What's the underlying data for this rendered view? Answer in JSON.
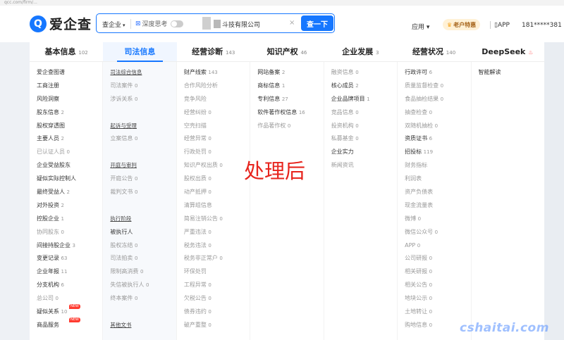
{
  "url": "qcc.com/firm/...",
  "header": {
    "logo_mark": "Q",
    "logo_text": "爱企查",
    "scope": "查企业",
    "deep": "深度思考",
    "query": "斗技有限公司",
    "search_btn": "查一下",
    "app_menu": "应用",
    "vip": "老户特惠",
    "app_link": "APP",
    "phone": "181*****381"
  },
  "tabs": [
    {
      "label": "基本信息",
      "count": "102"
    },
    {
      "label": "司法信息",
      "count": ""
    },
    {
      "label": "经营诊断",
      "count": "143"
    },
    {
      "label": "知识产权",
      "count": "46"
    },
    {
      "label": "企业发展",
      "count": "3"
    },
    {
      "label": "经营状况",
      "count": "140"
    },
    {
      "label": "DeepSeek",
      "count": ""
    }
  ],
  "columns": [
    [
      {
        "t": "爱企查图谱",
        "n": ""
      },
      {
        "t": "工商注册",
        "n": ""
      },
      {
        "t": "风险洞察",
        "n": ""
      },
      {
        "t": "股东信息",
        "n": "2"
      },
      {
        "t": "股权穿透图",
        "n": ""
      },
      {
        "t": "主要人员",
        "n": "2"
      },
      {
        "t": "已认证人员",
        "n": "0",
        "dim": true
      },
      {
        "t": "企业受益股东",
        "n": ""
      },
      {
        "t": "疑似实际控制人",
        "n": ""
      },
      {
        "t": "最终受益人",
        "n": "2"
      },
      {
        "t": "对外投资",
        "n": "2"
      },
      {
        "t": "控股企业",
        "n": "1"
      },
      {
        "t": "协同股东",
        "n": "0",
        "dim": true
      },
      {
        "t": "间接持股企业",
        "n": "3"
      },
      {
        "t": "变更记录",
        "n": "63"
      },
      {
        "t": "企业年报",
        "n": "11"
      },
      {
        "t": "分支机构",
        "n": "6"
      },
      {
        "t": "总公司",
        "n": "0",
        "dim": true
      },
      {
        "t": "疑似关系",
        "n": "10",
        "badge": "NEW"
      },
      {
        "t": "商品服务",
        "n": "",
        "badge": "NEW"
      }
    ],
    [
      {
        "t": "司法综合信息",
        "hdr": true
      },
      {
        "t": "司法案件",
        "n": "0",
        "dim": true
      },
      {
        "t": "涉诉关系",
        "n": "0",
        "dim": true
      },
      {
        "gap": true
      },
      {
        "t": "起诉与受理",
        "hdr": true
      },
      {
        "t": "立案信息",
        "n": "0",
        "dim": true
      },
      {
        "gap": true
      },
      {
        "t": "开庭与审判",
        "hdr": true
      },
      {
        "t": "开庭公告",
        "n": "0",
        "dim": true
      },
      {
        "t": "裁判文书",
        "n": "0",
        "dim": true
      },
      {
        "gap": true
      },
      {
        "t": "执行阶段",
        "hdr": true
      },
      {
        "t": "被执行人",
        "n": ""
      },
      {
        "t": "股权冻结",
        "n": "0",
        "dim": true
      },
      {
        "t": "司法拍卖",
        "n": "0",
        "dim": true
      },
      {
        "t": "限制高消费",
        "n": "0",
        "dim": true
      },
      {
        "t": "失信被执行人",
        "n": "0",
        "dim": true
      },
      {
        "t": "终本案件",
        "n": "0",
        "dim": true
      },
      {
        "gap": true
      },
      {
        "t": "其他文书",
        "hdr": true
      }
    ],
    [
      {
        "t": "财产线索",
        "n": "143"
      },
      {
        "t": "合作风险分析",
        "n": "",
        "dim": true
      },
      {
        "t": "竞争风险",
        "n": "",
        "dim": true
      },
      {
        "t": "经营纠纷",
        "n": "0",
        "dim": true
      },
      {
        "t": "空壳扫描",
        "n": "",
        "dim": true
      },
      {
        "t": "经营异常",
        "n": "0",
        "dim": true
      },
      {
        "t": "行政处罚",
        "n": "0",
        "dim": true
      },
      {
        "t": "知识产权出质",
        "n": "0",
        "dim": true
      },
      {
        "t": "股权出质",
        "n": "0",
        "dim": true
      },
      {
        "t": "动产抵押",
        "n": "0",
        "dim": true
      },
      {
        "t": "清算组信息",
        "n": "",
        "dim": true
      },
      {
        "t": "简易注销公告",
        "n": "0",
        "dim": true
      },
      {
        "t": "严重违法",
        "n": "0",
        "dim": true
      },
      {
        "t": "税务违法",
        "n": "0",
        "dim": true
      },
      {
        "t": "税务非正常户",
        "n": "0",
        "dim": true
      },
      {
        "t": "环保处罚",
        "n": "",
        "dim": true
      },
      {
        "t": "工程异常",
        "n": "0",
        "dim": true
      },
      {
        "t": "欠税公告",
        "n": "0",
        "dim": true
      },
      {
        "t": "债券违约",
        "n": "0",
        "dim": true
      },
      {
        "t": "破产重整",
        "n": "0",
        "dim": true
      }
    ],
    [
      {
        "t": "网站备案",
        "n": "2"
      },
      {
        "t": "商标信息",
        "n": "1"
      },
      {
        "t": "专利信息",
        "n": "27"
      },
      {
        "t": "软件著作权信息",
        "n": "16"
      },
      {
        "t": "作品著作权",
        "n": "0",
        "dim": true
      }
    ],
    [
      {
        "t": "融资信息",
        "n": "0",
        "dim": true
      },
      {
        "t": "核心成员",
        "n": "2"
      },
      {
        "t": "企业品牌项目",
        "n": "1"
      },
      {
        "t": "竞品信息",
        "n": "0",
        "dim": true
      },
      {
        "t": "投资机构",
        "n": "0",
        "dim": true
      },
      {
        "t": "私募基金",
        "n": "0",
        "dim": true
      },
      {
        "t": "企业实力",
        "n": ""
      },
      {
        "t": "新闻资讯",
        "n": "",
        "dim": true
      }
    ],
    [
      {
        "t": "行政许可",
        "n": "6"
      },
      {
        "t": "质量监督检查",
        "n": "0",
        "dim": true
      },
      {
        "t": "食品抽检结果",
        "n": "0",
        "dim": true
      },
      {
        "t": "抽查检查",
        "n": "0",
        "dim": true
      },
      {
        "t": "双随机抽检",
        "n": "0",
        "dim": true
      },
      {
        "t": "资质证书",
        "n": "6"
      },
      {
        "t": "招投标",
        "n": "119"
      },
      {
        "t": "财务指标",
        "n": "",
        "dim": true
      },
      {
        "t": "利润表",
        "n": "",
        "dim": true
      },
      {
        "t": "资产负债表",
        "n": "",
        "dim": true
      },
      {
        "t": "现金流量表",
        "n": "",
        "dim": true
      },
      {
        "t": "微博",
        "n": "0",
        "dim": true
      },
      {
        "t": "微信公众号",
        "n": "0",
        "dim": true
      },
      {
        "t": "APP",
        "n": "0",
        "dim": true
      },
      {
        "t": "公司研报",
        "n": "0",
        "dim": true
      },
      {
        "t": "相关研报",
        "n": "0",
        "dim": true
      },
      {
        "t": "相关公告",
        "n": "0",
        "dim": true
      },
      {
        "t": "地块公示",
        "n": "0",
        "dim": true
      },
      {
        "t": "土地转让",
        "n": "0",
        "dim": true
      },
      {
        "t": "购地信息",
        "n": "0",
        "dim": true
      }
    ],
    [
      {
        "t": "智能解读",
        "n": ""
      }
    ]
  ],
  "overlay": {
    "stamp": "处理后",
    "watermark": "cshaitai.com"
  },
  "colors": {
    "accent": "#1677ff",
    "stamp": "#e7251e",
    "badge": "#ff3b30"
  }
}
